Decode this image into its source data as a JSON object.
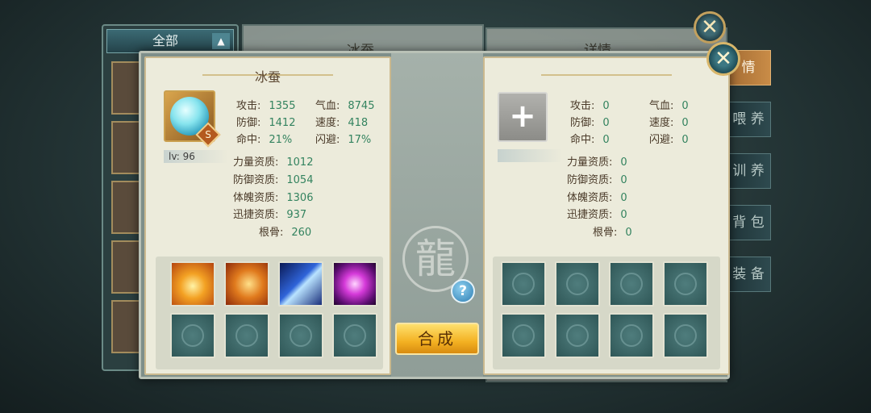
{
  "background": {
    "filter_label": "全部",
    "mid_title": "冰蚕",
    "right_title": "详情",
    "side_tabs": [
      {
        "label": "情",
        "active": true
      },
      {
        "label": "喂 养",
        "active": false
      },
      {
        "label": "训 养",
        "active": false
      },
      {
        "label": "背 包",
        "active": false
      },
      {
        "label": "装 备",
        "active": false
      }
    ]
  },
  "left_panel": {
    "title": "冰蚕",
    "level": "lv: 96",
    "rank_badge": "S",
    "attributes": [
      {
        "label": "攻击:",
        "value": "1355"
      },
      {
        "label": "气血:",
        "value": "8745"
      },
      {
        "label": "防御:",
        "value": "1412"
      },
      {
        "label": "速度:",
        "value": "418"
      },
      {
        "label": "命中:",
        "value": "21%"
      },
      {
        "label": "闪避:",
        "value": "17%"
      }
    ],
    "aptitudes": [
      {
        "label": "力量资质:",
        "value": "1012"
      },
      {
        "label": "防御资质:",
        "value": "1054"
      },
      {
        "label": "体魄资质:",
        "value": "1306"
      },
      {
        "label": "迅捷资质:",
        "value": "937"
      },
      {
        "label": "根骨:",
        "value": "260"
      }
    ],
    "skills": [
      "golden-burst-skill-icon",
      "fire-beast-skill-icon",
      "ice-claw-skill-icon",
      "purple-vortex-skill-icon"
    ]
  },
  "right_panel": {
    "add_symbol": "+",
    "attributes": [
      {
        "label": "攻击:",
        "value": "0"
      },
      {
        "label": "气血:",
        "value": "0"
      },
      {
        "label": "防御:",
        "value": "0"
      },
      {
        "label": "速度:",
        "value": "0"
      },
      {
        "label": "命中:",
        "value": "0"
      },
      {
        "label": "闪避:",
        "value": "0"
      }
    ],
    "aptitudes": [
      {
        "label": "力量资质:",
        "value": "0"
      },
      {
        "label": "防御资质:",
        "value": "0"
      },
      {
        "label": "体魄资质:",
        "value": "0"
      },
      {
        "label": "迅捷资质:",
        "value": "0"
      },
      {
        "label": "根骨:",
        "value": "0"
      }
    ]
  },
  "actions": {
    "help": "?",
    "compose": "合成",
    "close": "✕"
  },
  "colors": {
    "value_green": "#33835f",
    "label_brown": "#4a3a29",
    "button_gold": "#f3b122"
  }
}
